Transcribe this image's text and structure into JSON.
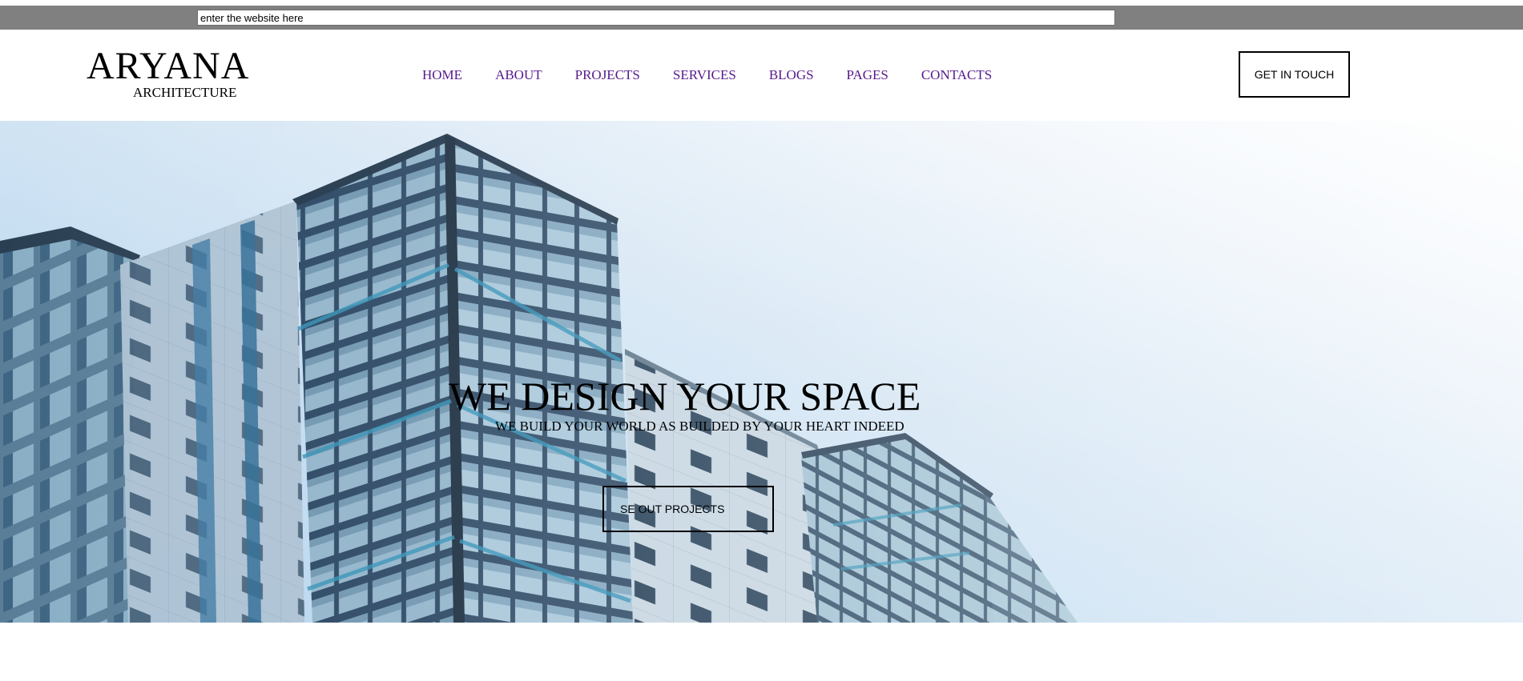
{
  "search": {
    "placeholder": "enter the website here",
    "value": ""
  },
  "header": {
    "logo_title": "ARYANA",
    "logo_subtitle": "ARCHITECTURE",
    "nav": [
      {
        "label": "HOME"
      },
      {
        "label": "ABOUT"
      },
      {
        "label": "PROJECTS"
      },
      {
        "label": "SERVICES"
      },
      {
        "label": "BLOGS"
      },
      {
        "label": "PAGES"
      },
      {
        "label": "CONTACTS"
      }
    ],
    "cta_label": "GET IN TOUCH"
  },
  "hero": {
    "title": "WE DESIGN YOUR SPACE",
    "subtitle": "WE BUILD YOUR WORLD AS BUILDED BY YOUR HEART INDEED",
    "button_label": "SE OUT PROJECTS",
    "image_description": "building-facade-photo"
  },
  "colors": {
    "top_strip": "#808080",
    "nav_link": "#551a8b",
    "sky_light": "#f1f6fb",
    "sky_blue": "#b5d3ee",
    "building_dark": "#1f3a55",
    "building_mid": "#4a6f8f",
    "glass": "#a9c4d6"
  }
}
